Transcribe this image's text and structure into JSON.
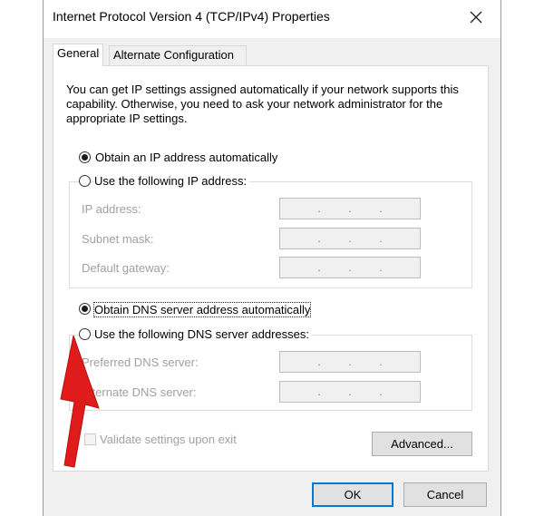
{
  "window": {
    "title": "Internet Protocol Version 4 (TCP/IPv4) Properties"
  },
  "tabs": [
    {
      "label": "General",
      "active": true
    },
    {
      "label": "Alternate Configuration",
      "active": false
    }
  ],
  "description": "You can get IP settings assigned automatically if your network supports this capability. Otherwise, you need to ask your network administrator for the appropriate IP settings.",
  "ip_section": {
    "auto_label": "Obtain an IP address automatically",
    "auto_selected": true,
    "manual_label": "Use the following IP address:",
    "manual_selected": false,
    "fields": [
      {
        "label": "IP address:",
        "value": ". . ."
      },
      {
        "label": "Subnet mask:",
        "value": ". . ."
      },
      {
        "label": "Default gateway:",
        "value": ". . ."
      }
    ]
  },
  "dns_section": {
    "auto_label": "Obtain DNS server address automatically",
    "auto_selected": true,
    "manual_label": "Use the following DNS server addresses:",
    "manual_selected": false,
    "fields": [
      {
        "label": "Preferred DNS server:",
        "value": ". . ."
      },
      {
        "label": "Alternate DNS server:",
        "value": ". . ."
      }
    ]
  },
  "validate": {
    "label": "Validate settings upon exit",
    "checked": false
  },
  "buttons": {
    "advanced": "Advanced...",
    "ok": "OK",
    "cancel": "Cancel"
  },
  "colors": {
    "dialog_bg": "#f0f0f0",
    "panel_bg": "#ffffff",
    "focus_border": "#0078d7",
    "arrow": "#e01b1b",
    "disabled_text": "#a0a0a0"
  }
}
